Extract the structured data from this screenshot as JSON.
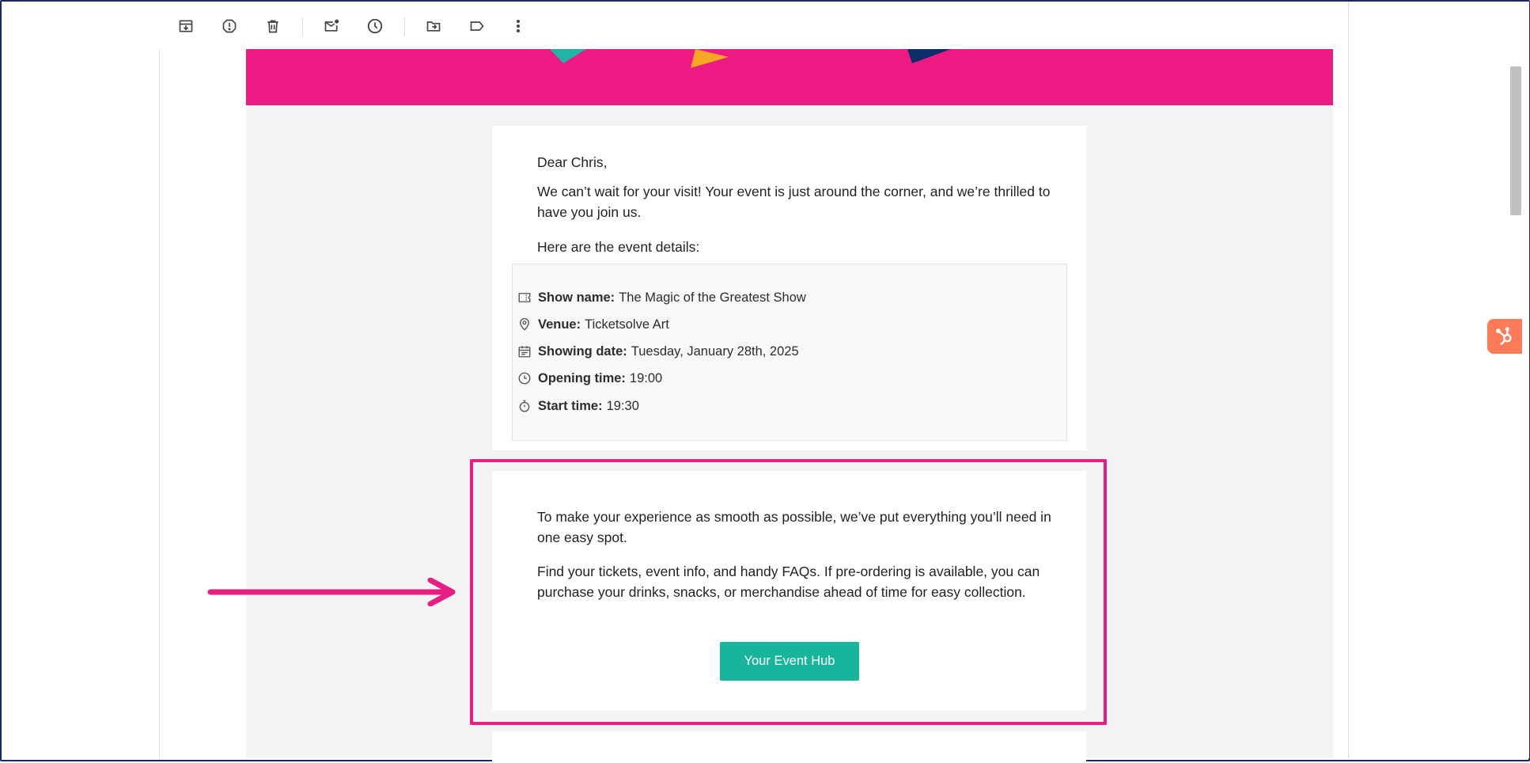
{
  "toolbar": {
    "buttons": [
      {
        "icon": "archive-icon"
      },
      {
        "icon": "report-spam-icon"
      },
      {
        "icon": "delete-icon"
      },
      {
        "icon": "mark-unread-icon"
      },
      {
        "icon": "snooze-icon"
      },
      {
        "icon": "move-to-icon"
      },
      {
        "icon": "label-icon"
      },
      {
        "icon": "more-options-icon"
      }
    ]
  },
  "email": {
    "greeting": "Dear Chris,",
    "intro": "We can’t wait for your visit! Your event is just around the corner, and we’re thrilled to have you join us.",
    "details_intro": "Here are the event details:",
    "details": {
      "show_label": "Show name:",
      "show_value": "The Magic of the Greatest Show",
      "venue_label": "Venue:",
      "venue_value": "Ticketsolve Art",
      "date_label": "Showing date:",
      "date_value": "Tuesday, January 28th, 2025",
      "opening_label": "Opening time:",
      "opening_value": "19:00",
      "start_label": "Start time:",
      "start_value": "19:30"
    },
    "hub_text_1": "To make your experience as smooth as possible, we’ve put everything you’ll need in one easy spot.",
    "hub_text_2": "Find your tickets, event info, and handy FAQs. If pre-ordering is available, you can purchase your drinks, snacks, or merchandise ahead of time for easy collection.",
    "hub_button": "Your Event Hub"
  },
  "colors": {
    "banner": "#ec1a82",
    "button": "#17b59b",
    "highlight": "#e81f82",
    "hubspot": "#ff7a59"
  },
  "widgets": {
    "hubspot_icon": "hubspot-sprocket-icon"
  }
}
